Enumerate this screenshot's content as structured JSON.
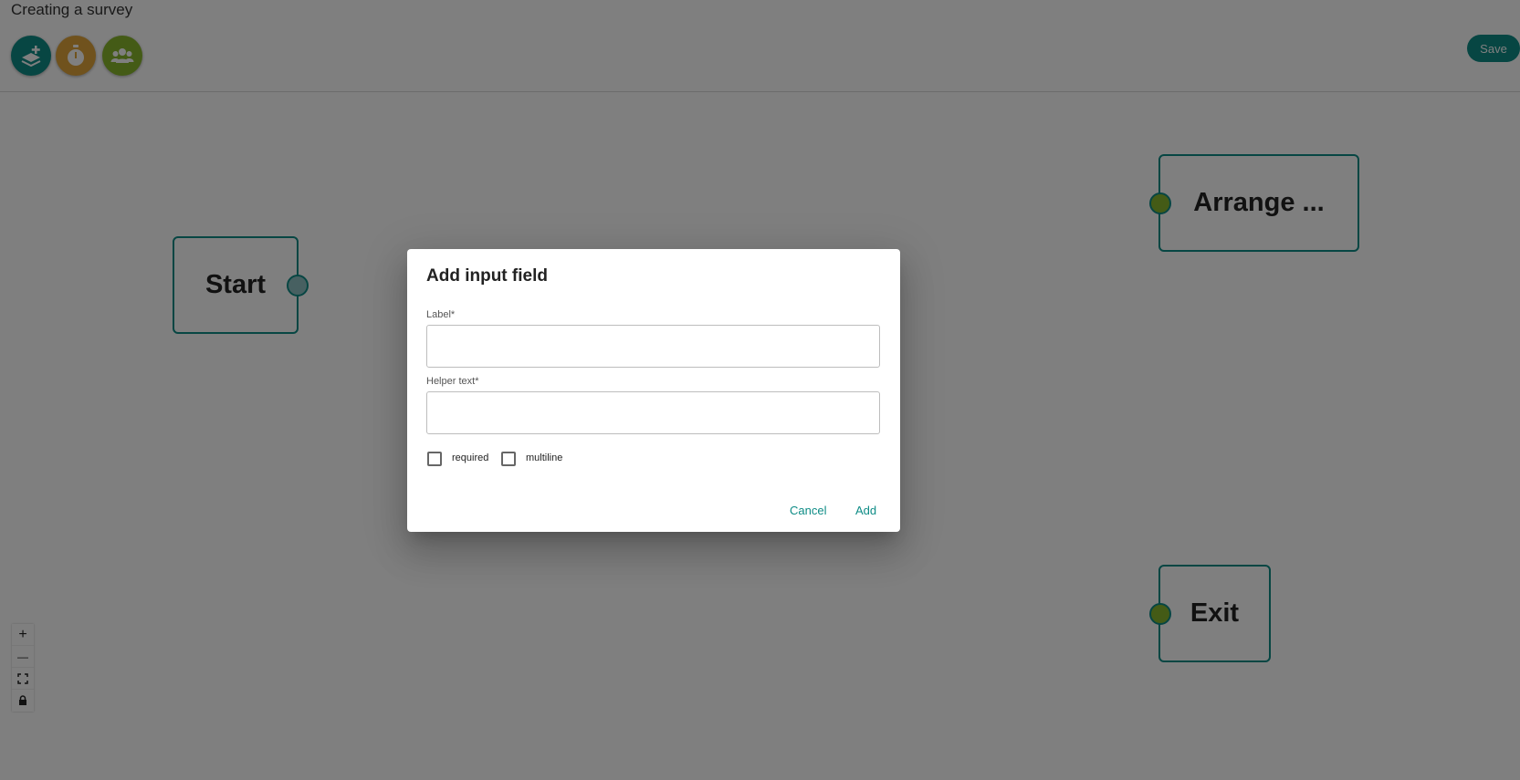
{
  "header": {
    "title": "Creating a survey",
    "tools": [
      {
        "name": "add-step",
        "icon": "layers-plus-icon",
        "color": "#0e8c86"
      },
      {
        "name": "timer",
        "icon": "stopwatch-icon",
        "color": "#e0a43a"
      },
      {
        "name": "audience",
        "icon": "group-icon",
        "color": "#88b72d"
      }
    ],
    "save_label": "Save",
    "accent_color": "#0e8c86"
  },
  "canvas": {
    "nodes": [
      {
        "label": "Start",
        "border_color": "#0e8c86",
        "handle_color": "#8fc1c3"
      },
      {
        "label": "Arrange ...",
        "border_color": "#0e8c86",
        "handle_color": "#88b72d"
      },
      {
        "label": "Exit",
        "border_color": "#0e8c86",
        "handle_color": "#88b72d"
      }
    ],
    "controls": {
      "zoom_in": "+",
      "zoom_out": "—",
      "fit_view_icon": "fit-view-icon",
      "lock_icon": "lock-icon"
    }
  },
  "dialog": {
    "title": "Add input field",
    "label_field": {
      "label": "Label*",
      "value": "",
      "placeholder": ""
    },
    "helper_field": {
      "label": "Helper text*",
      "value": "",
      "placeholder": ""
    },
    "checkboxes": [
      {
        "label": "required",
        "checked": false
      },
      {
        "label": "multiline",
        "checked": false
      }
    ],
    "cancel_label": "Cancel",
    "add_label": "Add",
    "button_color": "#0e8c86"
  }
}
